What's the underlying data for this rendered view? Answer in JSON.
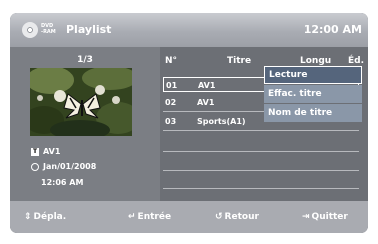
{
  "header": {
    "disc_type_line1": "DVD",
    "disc_type_line2": "-RAM",
    "title": "Playlist",
    "clock": "12:00 AM"
  },
  "left": {
    "page": "1/3",
    "thumbnail_icon": "butterfly-image",
    "title": "AV1",
    "date": "Jan/01/2008",
    "time": "12:06 AM"
  },
  "table": {
    "headers": {
      "num": "N°",
      "title": "Titre",
      "length": "Longu",
      "edit": "Éd."
    },
    "rows": [
      {
        "num": "01",
        "name": "AV1"
      },
      {
        "num": "02",
        "name": "AV1"
      },
      {
        "num": "03",
        "name": "Sports(A1)"
      }
    ]
  },
  "menu": {
    "items": [
      "Lecture",
      "Effac. titre",
      "Nom de titre"
    ],
    "selected_index": 0
  },
  "footer": {
    "move": {
      "icon": "up-down-arrows",
      "label": "Dépla."
    },
    "enter": {
      "icon": "enter-icon",
      "label": "Entrée"
    },
    "back": {
      "icon": "return-icon",
      "label": "Retour"
    },
    "quit": {
      "icon": "exit-icon",
      "label": "Quitter"
    }
  },
  "colors": {
    "panel": "#6c6f75",
    "highlight_menu": "#55657c",
    "menu": "#8a97a8",
    "bar": "#a9abb1"
  }
}
